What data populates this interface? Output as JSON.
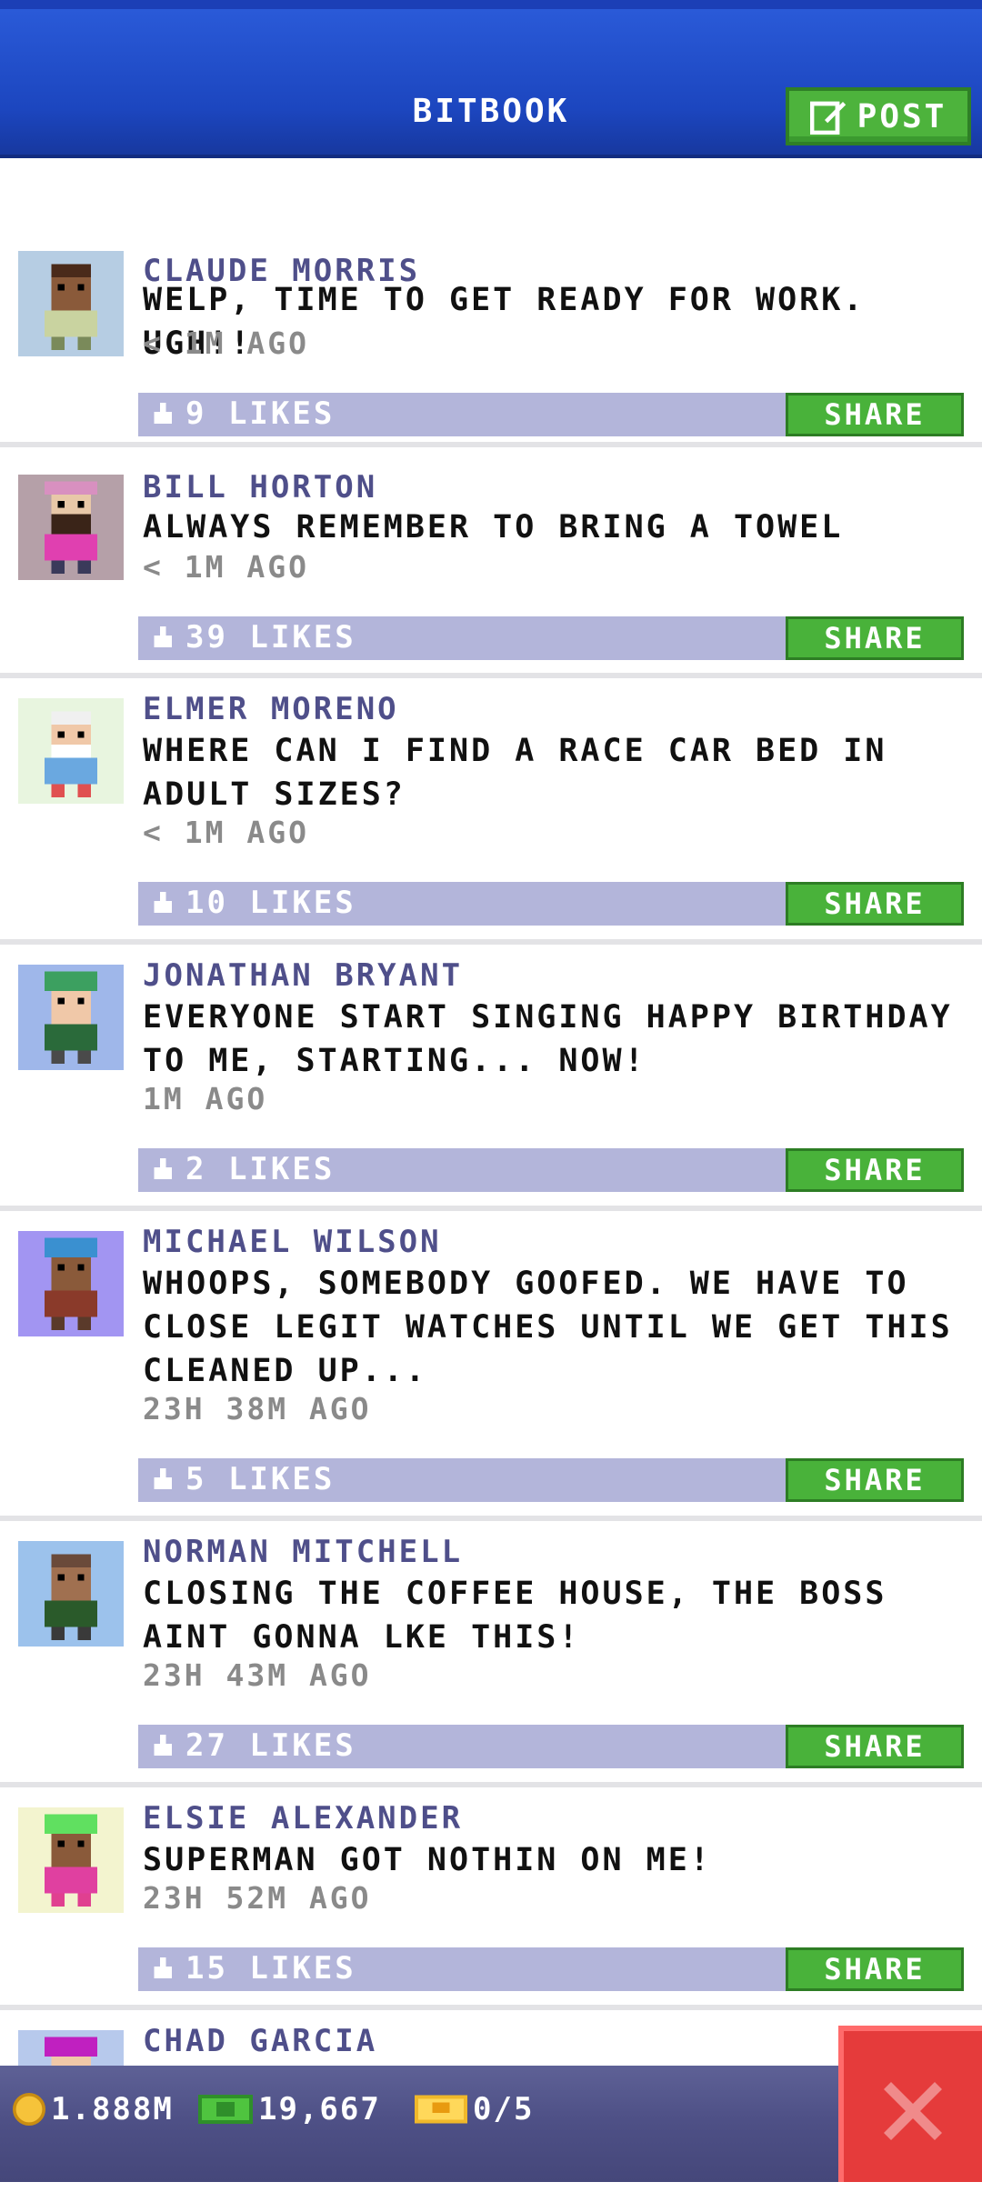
{
  "header": {
    "title": "BITBOOK",
    "post_label": "POST"
  },
  "posts": [
    {
      "author": "CLAUDE MORRIS",
      "message": "WELP, TIME TO GET READY FOR WORK. UGH!!",
      "time": "< 1M AGO",
      "likes": "9 LIKES",
      "share": "SHARE",
      "avatar_bg": "#b6cde3"
    },
    {
      "author": "BILL HORTON",
      "message": "ALWAYS REMEMBER TO BRING A TOWEL",
      "time": "< 1M AGO",
      "likes": "39 LIKES",
      "share": "SHARE",
      "avatar_bg": "#b5a0a8"
    },
    {
      "author": "ELMER MORENO",
      "message": "WHERE CAN I FIND A RACE CAR BED IN ADULT SIZES?",
      "time": "< 1M AGO",
      "likes": "10 LIKES",
      "share": "SHARE",
      "avatar_bg": "#e8f5df"
    },
    {
      "author": "JONATHAN BRYANT",
      "message": "EVERYONE START SINGING HAPPY BIRTHDAY TO ME, STARTING... NOW!",
      "time": "1M AGO",
      "likes": "2 LIKES",
      "share": "SHARE",
      "avatar_bg": "#9fb7ea"
    },
    {
      "author": "MICHAEL WILSON",
      "message": "WHOOPS, SOMEBODY GOOFED. WE HAVE TO CLOSE LEGIT WATCHES UNTIL WE GET THIS CLEANED UP...",
      "time": "23H 38M AGO",
      "likes": "5 LIKES",
      "share": "SHARE",
      "avatar_bg": "#a295f2"
    },
    {
      "author": "NORMAN MITCHELL",
      "message": "CLOSING THE COFFEE HOUSE, THE BOSS AINT GONNA LKE THIS!",
      "time": "23H 43M AGO",
      "likes": "27 LIKES",
      "share": "SHARE",
      "avatar_bg": "#9cc2ec"
    },
    {
      "author": "ELSIE ALEXANDER",
      "message": "SUPERMAN GOT NOTHIN ON ME!",
      "time": "23H 52M AGO",
      "likes": "15 LIKES",
      "share": "SHARE",
      "avatar_bg": "#f3f4cf"
    },
    {
      "author": "CHAD GARCIA",
      "avatar_bg": "#b7c9ec"
    }
  ],
  "bottom_bar": {
    "coins": "1.888M",
    "bux": "19,667",
    "vip": "0/5"
  },
  "colors": {
    "header_blue": "#1c46bf",
    "share_green": "#49b23a",
    "likes_bar": "#b3b5da",
    "close_red": "#e53b3b"
  }
}
